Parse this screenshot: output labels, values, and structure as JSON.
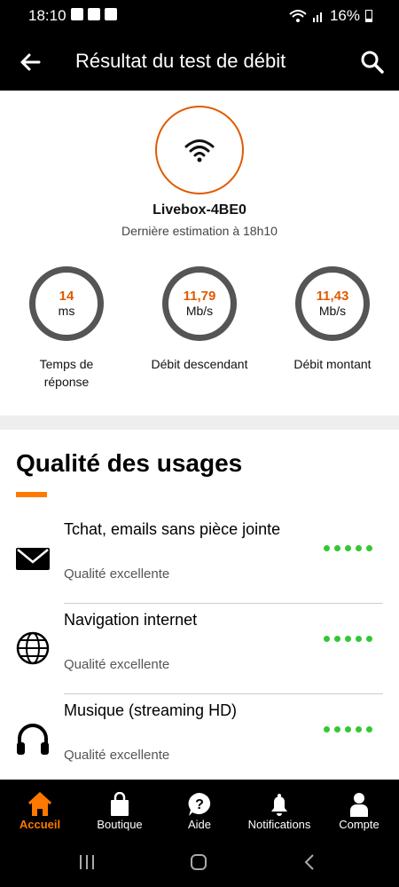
{
  "status_bar": {
    "time": "18:10",
    "battery": "16%"
  },
  "header": {
    "title": "Résultat du test de débit"
  },
  "router": {
    "name": "Livebox-4BE0",
    "estimate": "Dernière estimation à 18h10"
  },
  "metrics": [
    {
      "value": "14",
      "unit": "ms",
      "label": "Temps de réponse"
    },
    {
      "value": "11,79",
      "unit": "Mb/s",
      "label": "Débit descendant"
    },
    {
      "value": "11,43",
      "unit": "Mb/s",
      "label": "Débit montant"
    }
  ],
  "usage_section": {
    "title": "Qualité des usages",
    "items": [
      {
        "title": "Tchat, emails sans pièce jointe",
        "quality": "Qualité excellente",
        "icon": "mail-icon",
        "rating": 5
      },
      {
        "title": "Navigation internet",
        "quality": "Qualité excellente",
        "icon": "globe-icon",
        "rating": 5
      },
      {
        "title": "Musique (streaming HD)",
        "quality": "Qualité excellente",
        "icon": "headphones-icon",
        "rating": 5
      }
    ]
  },
  "bottom_nav": [
    {
      "label": "Accueil",
      "icon": "home-icon",
      "active": true
    },
    {
      "label": "Boutique",
      "icon": "shopping-bag-icon",
      "active": false
    },
    {
      "label": "Aide",
      "icon": "help-icon",
      "active": false
    },
    {
      "label": "Notifications",
      "icon": "bell-icon",
      "active": false
    },
    {
      "label": "Compte",
      "icon": "user-icon",
      "active": false
    }
  ],
  "colors": {
    "accent": "#ff7900",
    "metric_value": "#e05a00",
    "rating_dot": "#32c832"
  }
}
